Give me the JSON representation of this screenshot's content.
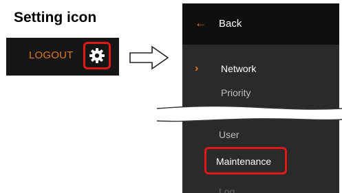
{
  "caption": "Setting icon",
  "left_bar": {
    "logout_label": "LOGOUT",
    "gear_icon": "gear-icon"
  },
  "menu": {
    "back_label": "Back",
    "items": [
      {
        "label": "Network",
        "selected": true
      },
      {
        "label": "Priority"
      },
      {
        "label": "User"
      },
      {
        "label": "Maintenance",
        "highlighted": true
      },
      {
        "label": "Log"
      }
    ]
  },
  "colors": {
    "accent_orange": "#e07a1a",
    "highlight_red": "#e01818",
    "bar_dark": "#161616",
    "panel_gray": "#2a2a2a"
  }
}
